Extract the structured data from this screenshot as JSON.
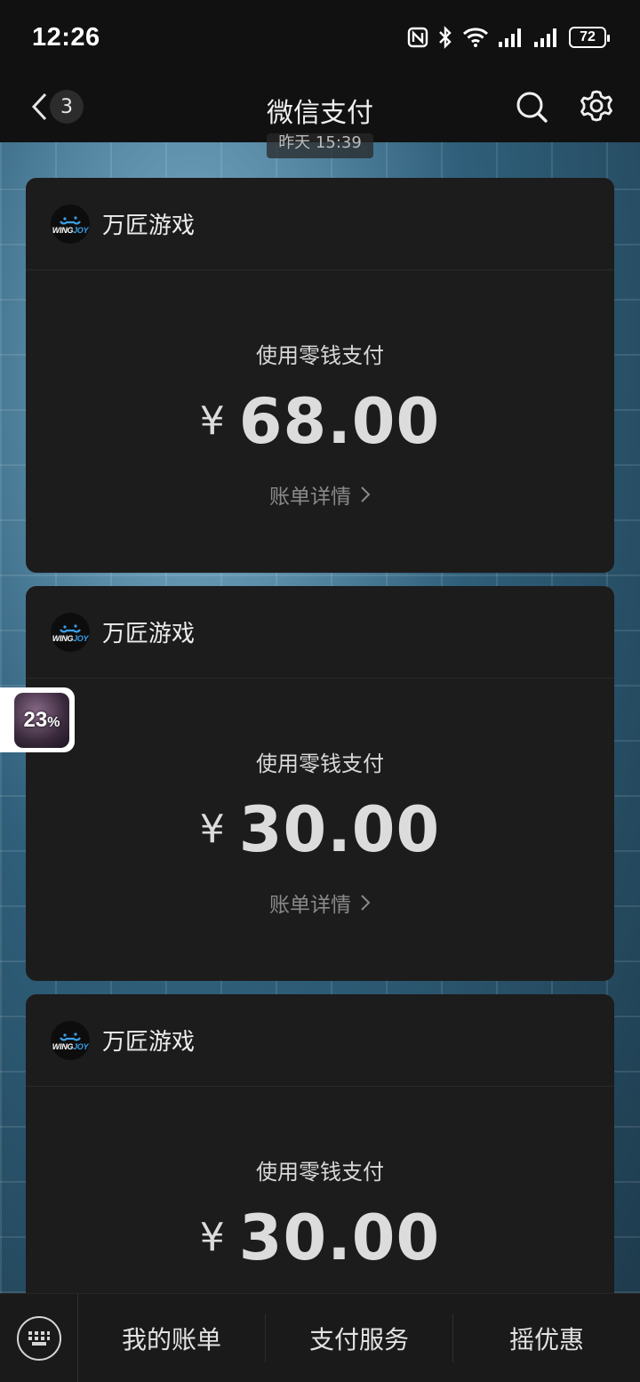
{
  "status_bar": {
    "time": "12:26",
    "battery": "72",
    "icons": [
      "nfc-icon",
      "bluetooth-icon",
      "wifi-icon",
      "signal-icon",
      "signal-icon",
      "battery-icon"
    ]
  },
  "nav": {
    "title": "微信支付",
    "unread_count": "3",
    "icons": [
      "back-icon",
      "search-icon",
      "settings-icon"
    ]
  },
  "timestamp_chip": "昨天 15:39",
  "cards": [
    {
      "merchant": "万匠游戏",
      "logo_text_a": "WING",
      "logo_text_b": "JOY",
      "pay_method": "使用零钱支付",
      "currency": "¥",
      "amount": "68.00",
      "detail_link": "账单详情"
    },
    {
      "merchant": "万匠游戏",
      "logo_text_a": "WING",
      "logo_text_b": "JOY",
      "pay_method": "使用零钱支付",
      "currency": "¥",
      "amount": "30.00",
      "detail_link": "账单详情"
    },
    {
      "merchant": "万匠游戏",
      "logo_text_a": "WING",
      "logo_text_b": "JOY",
      "pay_method": "使用零钱支付",
      "currency": "¥",
      "amount": "30.00"
    }
  ],
  "floating_widget": {
    "value": "23",
    "unit": "%"
  },
  "bottom_menu": {
    "keyboard_icon": "keyboard-icon",
    "items": [
      "我的账单",
      "支付服务",
      "摇优惠"
    ]
  },
  "colors": {
    "background": "#111111",
    "card": "#1c1c1c",
    "logo_accent": "#3aa0e8"
  }
}
